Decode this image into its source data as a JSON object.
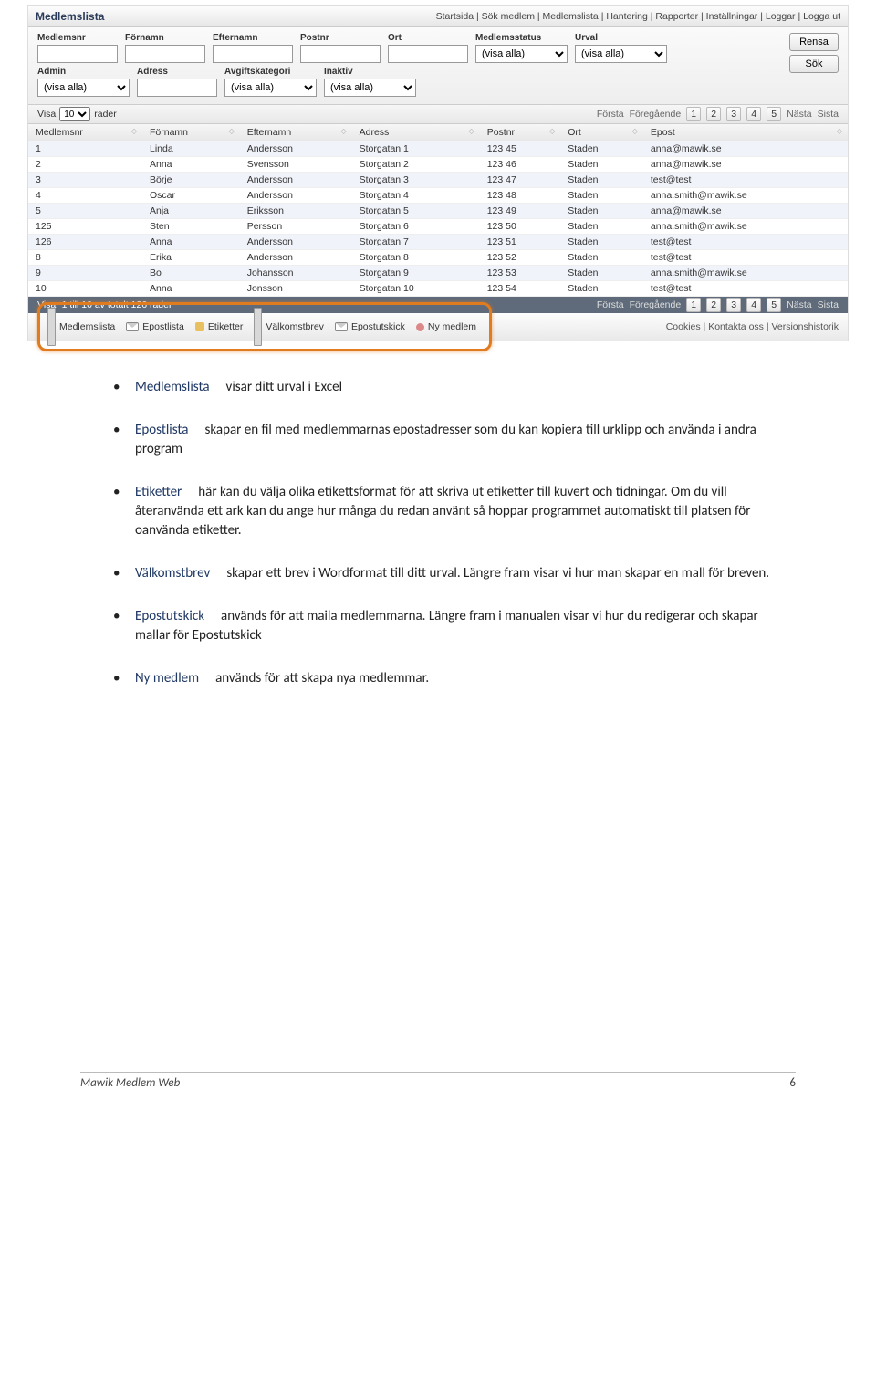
{
  "shot": {
    "title": "Medlemslista",
    "navlinks": "Startsida | Sök medlem | Medlemslista | Hantering | Rapporter | Inställningar | Loggar | Logga ut",
    "filters_row1": [
      {
        "label": "Medlemsnr",
        "type": "input",
        "val": ""
      },
      {
        "label": "Förnamn",
        "type": "input",
        "val": ""
      },
      {
        "label": "Efternamn",
        "type": "input",
        "val": ""
      },
      {
        "label": "Postnr",
        "type": "input",
        "val": ""
      },
      {
        "label": "Ort",
        "type": "input",
        "val": ""
      },
      {
        "label": "Medlemsstatus",
        "type": "select",
        "val": "(visa alla)"
      },
      {
        "label": "Urval",
        "type": "select",
        "val": "(visa alla)"
      }
    ],
    "filters_row2": [
      {
        "label": "Admin",
        "type": "select",
        "val": "(visa alla)"
      },
      {
        "label": "Adress",
        "type": "input",
        "val": ""
      },
      {
        "label": "Avgiftskategori",
        "type": "select",
        "val": "(visa alla)"
      },
      {
        "label": "Inaktiv",
        "type": "select",
        "val": "(visa alla)"
      }
    ],
    "btn_rensa": "Rensa",
    "btn_sok": "Sök",
    "visa_pre": "Visa",
    "visa_sel": "10",
    "visa_post": "rader",
    "pager_first": "Första",
    "pager_prev": "Föregående",
    "pager_pages": [
      "1",
      "2",
      "3",
      "4",
      "5"
    ],
    "pager_next": "Nästa",
    "pager_last": "Sista",
    "columns": [
      "Medlemsnr",
      "Förnamn",
      "Efternamn",
      "Adress",
      "Postnr",
      "Ort",
      "Epost"
    ],
    "rows": [
      [
        "1",
        "Linda",
        "Andersson",
        "Storgatan 1",
        "123 45",
        "Staden",
        "anna@mawik.se"
      ],
      [
        "2",
        "Anna",
        "Svensson",
        "Storgatan 2",
        "123 46",
        "Staden",
        "anna@mawik.se"
      ],
      [
        "3",
        "Börje",
        "Andersson",
        "Storgatan 3",
        "123 47",
        "Staden",
        "test@test"
      ],
      [
        "4",
        "Oscar",
        "Andersson",
        "Storgatan 4",
        "123 48",
        "Staden",
        "anna.smith@mawik.se"
      ],
      [
        "5",
        "Anja",
        "Eriksson",
        "Storgatan 5",
        "123 49",
        "Staden",
        "anna@mawik.se"
      ],
      [
        "125",
        "Sten",
        "Persson",
        "Storgatan 6",
        "123 50",
        "Staden",
        "anna.smith@mawik.se"
      ],
      [
        "126",
        "Anna",
        "Andersson",
        "Storgatan 7",
        "123 51",
        "Staden",
        "test@test"
      ],
      [
        "8",
        "Erika",
        "Andersson",
        "Storgatan 8",
        "123 52",
        "Staden",
        "test@test"
      ],
      [
        "9",
        "Bo",
        "Johansson",
        "Storgatan 9",
        "123 53",
        "Staden",
        "anna.smith@mawik.se"
      ],
      [
        "10",
        "Anna",
        "Jonsson",
        "Storgatan 10",
        "123 54",
        "Staden",
        "test@test"
      ]
    ],
    "status_text": "Visar 1 till 10 av totalt 126 rader",
    "actions": [
      {
        "icon": "page",
        "label": "Medlemslista"
      },
      {
        "icon": "mail",
        "label": "Epostlista"
      },
      {
        "icon": "tag",
        "label": "Etiketter"
      },
      {
        "icon": "page",
        "label": "Välkomstbrev"
      },
      {
        "icon": "mail",
        "label": "Epostutskick"
      },
      {
        "icon": "person",
        "label": "Ny medlem"
      }
    ],
    "footlinks": "Cookies | Kontakta oss | Versionshistorik"
  },
  "body": {
    "items": [
      {
        "term": "Medlemslista",
        "text": "visar ditt urval i Excel"
      },
      {
        "term": "Epostlista",
        "text": "skapar en fil med medlemmarnas epostadresser som du kan kopiera till urklipp och använda i andra program"
      },
      {
        "term": "Etiketter",
        "text": "här kan du välja olika etikettsformat för att skriva ut etiketter till kuvert och tidningar. Om du vill återanvända ett ark kan du ange hur många du redan använt så hoppar programmet automatiskt till platsen för oanvända etiketter."
      },
      {
        "term": "Välkomstbrev",
        "text": "skapar ett brev i Wordformat till ditt urval. Längre fram visar vi hur man skapar en mall för breven."
      },
      {
        "term": "Epostutskick",
        "text": "används för att maila medlemmarna. Längre fram i manualen visar vi hur du redigerar och skapar mallar för Epostutskick"
      },
      {
        "term": "Ny medlem",
        "text": "används för att skapa nya medlemmar."
      }
    ]
  },
  "footer": {
    "left": "Mawik Medlem Web",
    "right": "6"
  }
}
